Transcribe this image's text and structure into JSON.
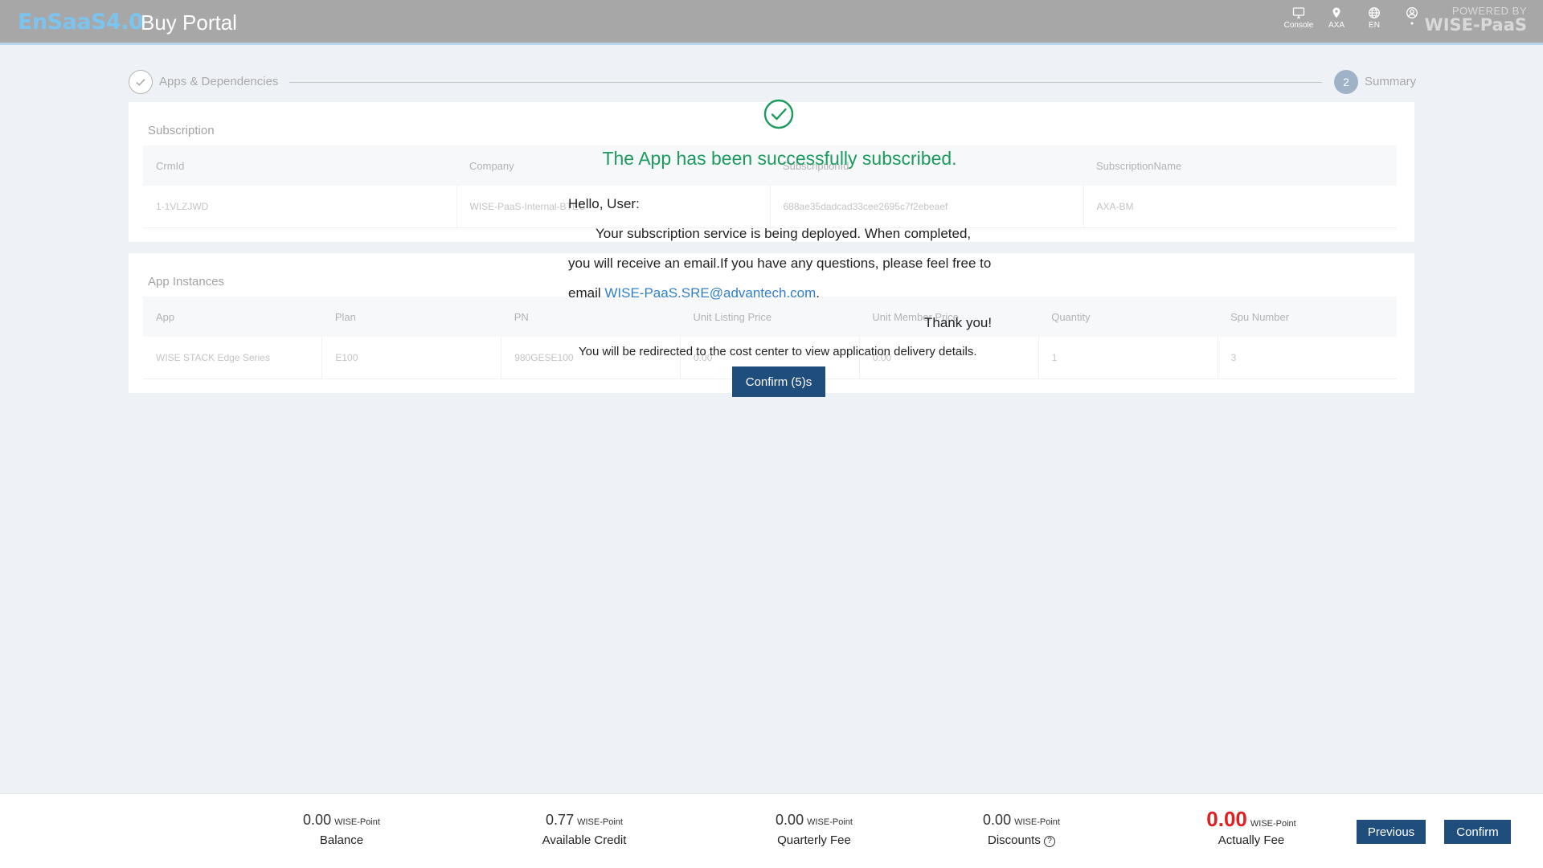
{
  "header": {
    "logo_text": "EnSaaS4.0",
    "title": "Buy Portal",
    "tools": [
      {
        "icon": "monitor-icon",
        "label": "Console"
      },
      {
        "icon": "location-pin-icon",
        "label": "AXA"
      },
      {
        "icon": "globe-icon",
        "label": "EN"
      },
      {
        "icon": "user-icon",
        "label": "●"
      }
    ],
    "powered_by_line1": "POWERED BY",
    "powered_by_line2": "WISE-PaaS"
  },
  "stepper": {
    "steps": [
      {
        "label": "Apps & Dependencies",
        "state": "done"
      },
      {
        "number": "2",
        "label": "Summary",
        "state": "active"
      }
    ]
  },
  "subscription": {
    "title": "Subscription",
    "columns": [
      "CrmId",
      "Company",
      "SubscriptionId",
      "SubscriptionName"
    ],
    "row": [
      "1-1VLZJWD",
      "WISE-PaaS-Internal-BTEC",
      "688ae35dadcad33cee2695c7f2ebeaef",
      "AXA-BM"
    ]
  },
  "app_instances": {
    "title": "App Instances",
    "columns": [
      "App",
      "Plan",
      "PN",
      "Unit Listing Price",
      "Unit Member Price",
      "Quantity",
      "Spu Number"
    ],
    "row": [
      "WISE STACK Edge Series",
      "E100",
      "980GESE100",
      "0.00",
      "0.00",
      "1",
      "3"
    ]
  },
  "dialog": {
    "title": "The App has been successfully subscribed.",
    "greeting": "Hello, User:",
    "line1": "Your subscription service is being deployed. When completed,",
    "line2": "you will receive an email.If you have any questions, please feel free to",
    "line3_prefix": "email ",
    "email": "WISE-PaaS.SRE@advantech.com",
    "line3_suffix": ".",
    "thanks": "Thank you!",
    "redirect_note": "You will be redirected to the cost center to view application delivery details.",
    "confirm_label": "Confirm  (5)s",
    "success_color": "#1d9a5e"
  },
  "footer": {
    "fees": [
      {
        "value": "0.00",
        "unit": "WISE-Point",
        "label": "Balance"
      },
      {
        "value": "0.77",
        "unit": "WISE-Point",
        "label": "Available Credit"
      },
      {
        "value": "0.00",
        "unit": "WISE-Point",
        "label": "Quarterly Fee"
      },
      {
        "value": "0.00",
        "unit": "WISE-Point",
        "label": "Discounts"
      },
      {
        "value": "0.00",
        "unit": "WISE-Point",
        "label": "Actually Fee"
      }
    ],
    "previous_label": "Previous",
    "confirm_label": "Confirm",
    "accent_color": "#1f4e7d",
    "total_color": "#e02020"
  }
}
